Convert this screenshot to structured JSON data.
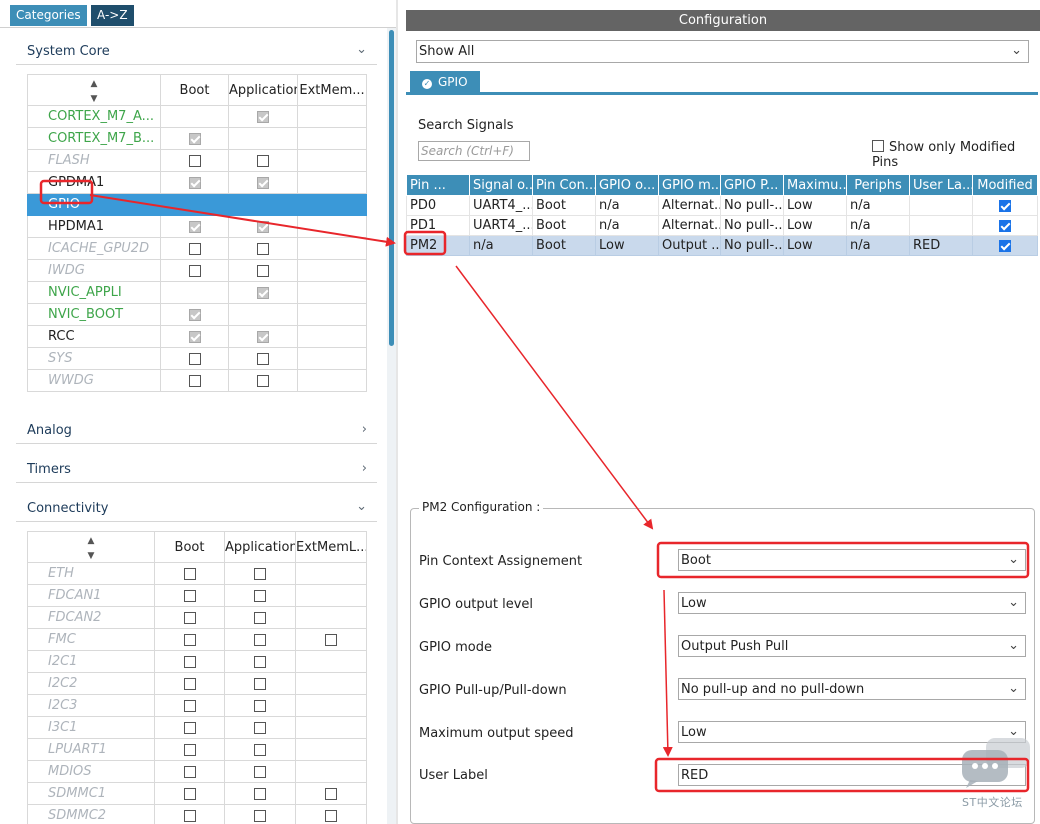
{
  "left_tabs": {
    "categories": "Categories",
    "az": "A->Z"
  },
  "system_core": {
    "title": "System Core",
    "columns": [
      "Boot",
      "Application",
      "ExtMem..."
    ],
    "rows": [
      {
        "name": "CORTEX_M7_A...",
        "style": "green",
        "boot": null,
        "app": "checked",
        "ext": null
      },
      {
        "name": "CORTEX_M7_B...",
        "style": "green",
        "boot": "checked",
        "app": null,
        "ext": null
      },
      {
        "name": "FLASH",
        "style": "gray",
        "boot": "empty",
        "app": "empty",
        "ext": null
      },
      {
        "name": "GPDMA1",
        "style": "black",
        "boot": "checked",
        "app": "checked",
        "ext": null
      },
      {
        "name": "GPIO",
        "style": "selected",
        "boot": null,
        "app": null,
        "ext": null
      },
      {
        "name": "HPDMA1",
        "style": "black",
        "boot": "checked",
        "app": "checked",
        "ext": null
      },
      {
        "name": "ICACHE_GPU2D",
        "style": "gray",
        "boot": "empty",
        "app": "empty",
        "ext": null
      },
      {
        "name": "IWDG",
        "style": "gray",
        "boot": "empty",
        "app": "empty",
        "ext": null
      },
      {
        "name": "NVIC_APPLI",
        "style": "green",
        "boot": null,
        "app": "checked",
        "ext": null
      },
      {
        "name": "NVIC_BOOT",
        "style": "green",
        "boot": "checked",
        "app": null,
        "ext": null
      },
      {
        "name": "RCC",
        "style": "black",
        "boot": "checked",
        "app": "checked",
        "ext": null
      },
      {
        "name": "SYS",
        "style": "gray",
        "boot": "empty",
        "app": "empty",
        "ext": null
      },
      {
        "name": "WWDG",
        "style": "gray",
        "boot": "empty",
        "app": "empty",
        "ext": null
      }
    ]
  },
  "analog": {
    "title": "Analog"
  },
  "timers": {
    "title": "Timers"
  },
  "connectivity": {
    "title": "Connectivity",
    "columns": [
      "Boot",
      "Application",
      "ExtMemL..."
    ],
    "rows": [
      {
        "name": "ETH",
        "style": "gray",
        "boot": "empty",
        "app": "empty",
        "ext": null
      },
      {
        "name": "FDCAN1",
        "style": "gray",
        "boot": "empty",
        "app": "empty",
        "ext": null
      },
      {
        "name": "FDCAN2",
        "style": "gray",
        "boot": "empty",
        "app": "empty",
        "ext": null
      },
      {
        "name": "FMC",
        "style": "gray",
        "boot": "empty",
        "app": "empty",
        "ext": "empty"
      },
      {
        "name": "I2C1",
        "style": "gray",
        "boot": "empty",
        "app": "empty",
        "ext": null
      },
      {
        "name": "I2C2",
        "style": "gray",
        "boot": "empty",
        "app": "empty",
        "ext": null
      },
      {
        "name": "I2C3",
        "style": "gray",
        "boot": "empty",
        "app": "empty",
        "ext": null
      },
      {
        "name": "I3C1",
        "style": "gray",
        "boot": "empty",
        "app": "empty",
        "ext": null
      },
      {
        "name": "LPUART1",
        "style": "gray",
        "boot": "empty",
        "app": "empty",
        "ext": null
      },
      {
        "name": "MDIOS",
        "style": "gray",
        "boot": "empty",
        "app": "empty",
        "ext": null
      },
      {
        "name": "SDMMC1",
        "style": "gray",
        "boot": "empty",
        "app": "empty",
        "ext": "empty"
      },
      {
        "name": "SDMMC2",
        "style": "gray",
        "boot": "empty",
        "app": "empty",
        "ext": "empty"
      }
    ]
  },
  "configuration": {
    "title": "Configuration",
    "filter": "Show All",
    "tab": "GPIO",
    "search_label": "Search Signals",
    "search_placeholder": "Search (Ctrl+F)",
    "show_modified_label": "Show only Modified Pins",
    "pin_columns": [
      "Pin ...",
      "Signal o...",
      "Pin Con...",
      "GPIO o...",
      "GPIO m...",
      "GPIO P...",
      "Maximu...",
      "Periphs",
      "User La...",
      "Modified"
    ],
    "pins": [
      {
        "cells": [
          "PD0",
          "UART4_...",
          "Boot",
          "n/a",
          "Alternat...",
          "No pull-...",
          "Low",
          "n/a",
          ""
        ],
        "selected": false
      },
      {
        "cells": [
          "PD1",
          "UART4_...",
          "Boot",
          "n/a",
          "Alternat...",
          "No pull-...",
          "Low",
          "n/a",
          ""
        ],
        "selected": false
      },
      {
        "cells": [
          "PM2",
          "n/a",
          "Boot",
          "Low",
          "Output ...",
          "No pull-...",
          "Low",
          "n/a",
          "RED"
        ],
        "selected": true
      }
    ]
  },
  "pm2_config": {
    "title": "PM2 Configuration :",
    "fields": [
      {
        "label": "Pin Context Assignement",
        "value": "Boot"
      },
      {
        "label": "GPIO output level",
        "value": "Low"
      },
      {
        "label": "GPIO mode",
        "value": "Output Push Pull"
      },
      {
        "label": "GPIO Pull-up/Pull-down",
        "value": "No pull-up and no pull-down"
      },
      {
        "label": "Maximum output speed",
        "value": "Low"
      }
    ],
    "user_label": {
      "label": "User Label",
      "value": "RED"
    }
  },
  "watermark": {
    "text": "ST中文论坛"
  },
  "colors": {
    "accent": "#3d8eb7",
    "highlight": "#e8262b",
    "enabled": "#3ea54a"
  }
}
